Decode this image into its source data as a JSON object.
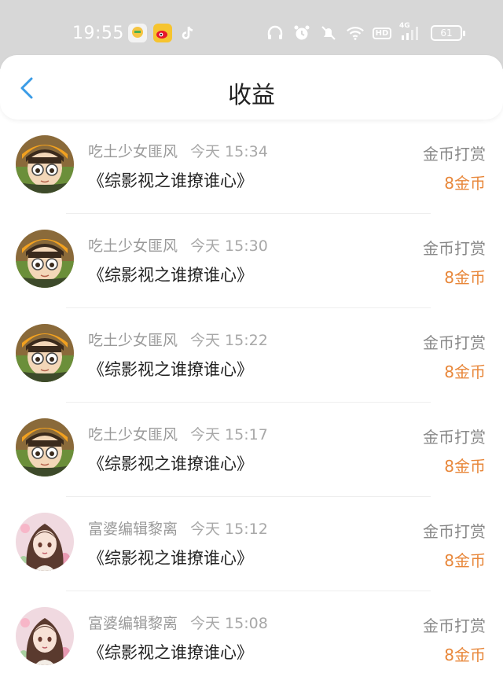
{
  "status_bar": {
    "time": "19:55",
    "battery": "61",
    "apps": [
      "map-app-icon",
      "weibo-icon",
      "tiktok-icon"
    ],
    "indicators": [
      "headphones-icon",
      "alarm-icon",
      "mute-icon",
      "wifi-icon",
      "hd-icon",
      "signal-4g-icon",
      "battery-icon"
    ],
    "network_label": "4G",
    "hd_label": "HD"
  },
  "header": {
    "title": "收益",
    "back_icon": "chevron-left-icon",
    "accent_color": "#3a9be6"
  },
  "colors": {
    "amount": "#e8873a",
    "status_bar_bg": "#d7d7d7"
  },
  "records": [
    {
      "user": "吃土少女匪风",
      "time": "今天 15:34",
      "book": "《综影视之谁撩谁心》",
      "type": "金币打赏",
      "amount": "8金币",
      "avatar": "cartoon-girl-avatar"
    },
    {
      "user": "吃土少女匪风",
      "time": "今天 15:30",
      "book": "《综影视之谁撩谁心》",
      "type": "金币打赏",
      "amount": "8金币",
      "avatar": "cartoon-girl-avatar"
    },
    {
      "user": "吃土少女匪风",
      "time": "今天 15:22",
      "book": "《综影视之谁撩谁心》",
      "type": "金币打赏",
      "amount": "8金币",
      "avatar": "cartoon-girl-avatar"
    },
    {
      "user": "吃土少女匪风",
      "time": "今天 15:17",
      "book": "《综影视之谁撩谁心》",
      "type": "金币打赏",
      "amount": "8金币",
      "avatar": "cartoon-girl-avatar"
    },
    {
      "user": "富婆编辑黎离",
      "time": "今天 15:12",
      "book": "《综影视之谁撩谁心》",
      "type": "金币打赏",
      "amount": "8金币",
      "avatar": "anime-lady-avatar"
    },
    {
      "user": "富婆编辑黎离",
      "time": "今天 15:08",
      "book": "《综影视之谁撩谁心》",
      "type": "金币打赏",
      "amount": "8金币",
      "avatar": "anime-lady-avatar"
    }
  ]
}
